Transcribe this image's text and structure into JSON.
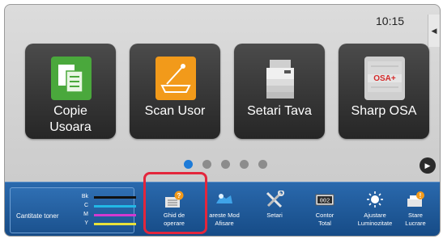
{
  "status": {
    "time": "10:15",
    "side_tab_glyph": "◀"
  },
  "tiles": [
    {
      "label": "Copie\nUsoara",
      "icon": "copy-icon",
      "color": "#4aa83c"
    },
    {
      "label": "Scan Usor",
      "icon": "scan-icon",
      "color": "#f29a1a"
    },
    {
      "label": "Setari Tava",
      "icon": "printer-tray-icon",
      "color": "#e8e8e8"
    },
    {
      "label": "Sharp OSA",
      "icon": "sharp-osa-icon",
      "color": "#c9c9c9"
    }
  ],
  "pager": {
    "count": 5,
    "active": 0,
    "next_glyph": "▶"
  },
  "toner": {
    "title": "Cantitate toner",
    "levels": [
      {
        "key": "Bk",
        "color": "#111111",
        "level": 1.0
      },
      {
        "key": "C",
        "color": "#22b8e6",
        "level": 1.0
      },
      {
        "key": "M",
        "color": "#d23ad0",
        "level": 1.0
      },
      {
        "key": "Y",
        "color": "#e7e13a",
        "level": 1.0
      }
    ]
  },
  "bottom_buttons": [
    {
      "label": "Ghid de\noperare",
      "icon": "guide-icon"
    },
    {
      "label": "areste Mod\nAfisare",
      "icon": "display-mode-icon"
    },
    {
      "label": "Setari",
      "icon": "tools-icon"
    },
    {
      "label": "Contor\nTotal",
      "icon": "counter-icon",
      "counter_text": "002"
    },
    {
      "label": "Ajustare\nLuminozitate",
      "icon": "brightness-icon"
    },
    {
      "label": "Stare\nLucrare",
      "icon": "job-status-icon"
    }
  ],
  "colors": {
    "highlight": "#e3263c",
    "bar": "#1f5c9e",
    "active_dot": "#1d7bd8"
  }
}
